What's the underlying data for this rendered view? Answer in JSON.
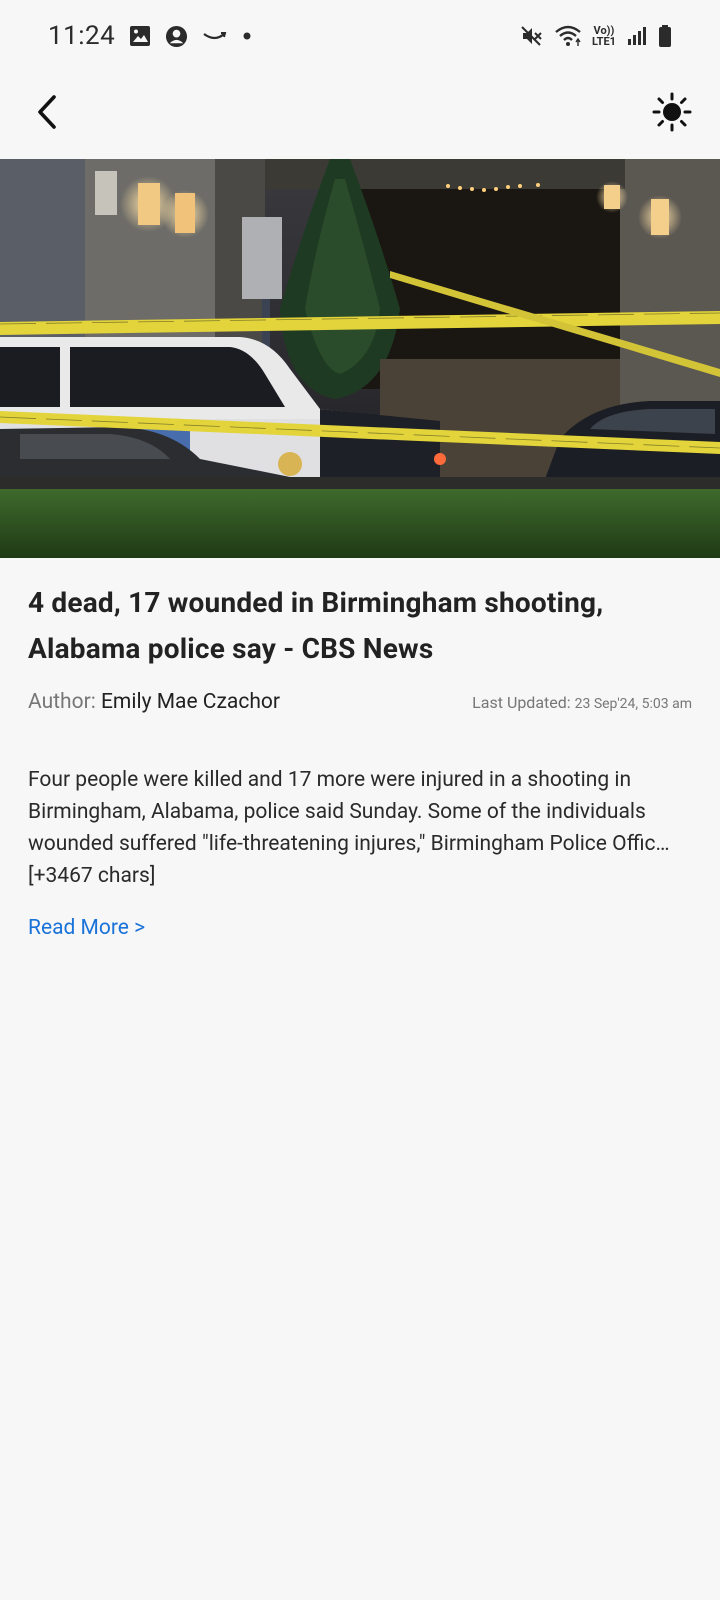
{
  "status_bar": {
    "time": "11:24",
    "left_icons": [
      "gallery-icon",
      "account-icon",
      "amazon-icon",
      "dot-icon"
    ],
    "right_icons": [
      "mute-icon",
      "wifi-icon",
      "volte-icon",
      "signal-icon",
      "battery-icon"
    ],
    "volte_top": "Vo))",
    "volte_bottom": "LTE1"
  },
  "app_bar": {
    "back_icon": "back-arrow-icon",
    "theme_icon": "sun-icon"
  },
  "article": {
    "title": "4 dead, 17 wounded in Birmingham shooting, Alabama police say - CBS News",
    "author_label": "Author: ",
    "author_name": "Emily Mae Czachor",
    "updated_label": "Last Updated: ",
    "updated_value": "23 Sep'24, 5:03 am",
    "description": "Four people were killed and 17 more were injured in a shooting in Birmingham, Alabama, police said Sunday. Some of the individuals wounded suffered \"life-threatening injures,\" Birmingham Police Offic… [+3467 chars]",
    "read_more": "Read More >"
  },
  "colors": {
    "background": "#f7f7f7",
    "link": "#1a73d9",
    "tape": "#e2d43a"
  }
}
